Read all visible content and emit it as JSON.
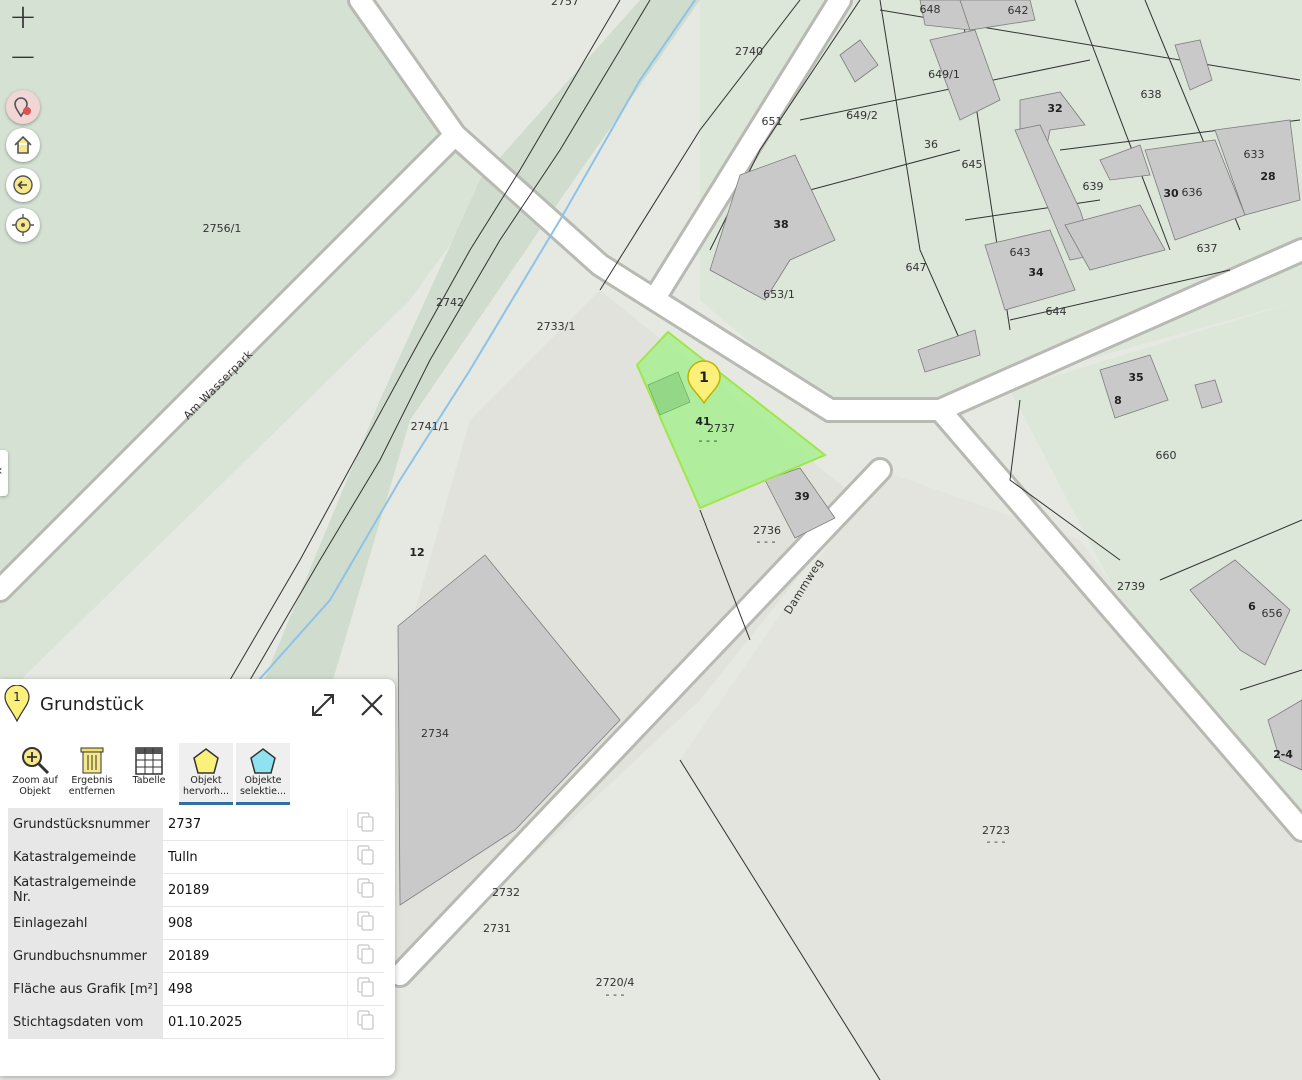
{
  "map": {
    "parcel_labels": [
      {
        "text": "2757"
      },
      {
        "text": "648"
      },
      {
        "text": "642"
      },
      {
        "text": "2740"
      },
      {
        "text": "649/1"
      },
      {
        "text": "638"
      },
      {
        "text": "651"
      },
      {
        "text": "649/2"
      },
      {
        "text": "36"
      },
      {
        "text": "645"
      },
      {
        "text": "633"
      },
      {
        "text": "639"
      },
      {
        "text": "636"
      },
      {
        "text": "637"
      },
      {
        "text": "2756/1"
      },
      {
        "text": "647"
      },
      {
        "text": "643"
      },
      {
        "text": "653/1"
      },
      {
        "text": "644"
      },
      {
        "text": "2742"
      },
      {
        "text": "2733/1"
      },
      {
        "text": "2741/1"
      },
      {
        "text": "660"
      },
      {
        "text": "2736"
      },
      {
        "text": "2739"
      },
      {
        "text": "656"
      },
      {
        "text": "2734"
      },
      {
        "text": "2723"
      },
      {
        "text": "2732"
      },
      {
        "text": "2731"
      },
      {
        "text": "2720/4"
      },
      {
        "text": "2737"
      }
    ],
    "house_numbers": [
      {
        "text": "32"
      },
      {
        "text": "28"
      },
      {
        "text": "30"
      },
      {
        "text": "38"
      },
      {
        "text": "34"
      },
      {
        "text": "35"
      },
      {
        "text": "8"
      },
      {
        "text": "39"
      },
      {
        "text": "41"
      },
      {
        "text": "12"
      },
      {
        "text": "6"
      },
      {
        "text": "2-4"
      }
    ],
    "dashes": "- - -",
    "streets": {
      "wasserpark": "Am Wasserpark",
      "dammweg": "Dammweg"
    },
    "marker_number": "1",
    "colors": {
      "highlight_fill": "#a7ef92",
      "highlight_stroke": "#a0e64a",
      "building": "#c9c9c9",
      "marker": "#fbf07a"
    }
  },
  "controls": {
    "zoom_in": "+",
    "zoom_out": "−",
    "icons": [
      "zoom-in-icon",
      "zoom-out-icon",
      "location-pin-icon",
      "home-icon",
      "back-arrow-icon",
      "locate-crosshair-icon"
    ]
  },
  "panel": {
    "marker_number": "1",
    "title": "Grundstück",
    "tools": [
      {
        "label": "Zoom auf Objekt",
        "icon": "magnifier-plus-icon"
      },
      {
        "label": "Ergebnis entfernen",
        "icon": "trash-icon"
      },
      {
        "label": "Tabelle",
        "icon": "table-icon"
      },
      {
        "label": "Objekt hervorh...",
        "icon": "pentagon-yellow-icon",
        "selected": true
      },
      {
        "label": "Objekte selektie...",
        "icon": "pentagon-blue-icon",
        "selected": true
      }
    ],
    "attributes": [
      {
        "key": "Grundstücksnummer",
        "value": "2737"
      },
      {
        "key": "Katastralgemeinde",
        "value": "Tulln"
      },
      {
        "key": "Katastralgemeinde Nr.",
        "value": "20189"
      },
      {
        "key": "Einlagezahl",
        "value": "908"
      },
      {
        "key": "Grundbuchsnummer",
        "value": "20189"
      },
      {
        "key": "Fläche aus Grafik [m²]",
        "value": "498"
      },
      {
        "key": "Stichtagsdaten vom",
        "value": "01.10.2025"
      }
    ]
  }
}
